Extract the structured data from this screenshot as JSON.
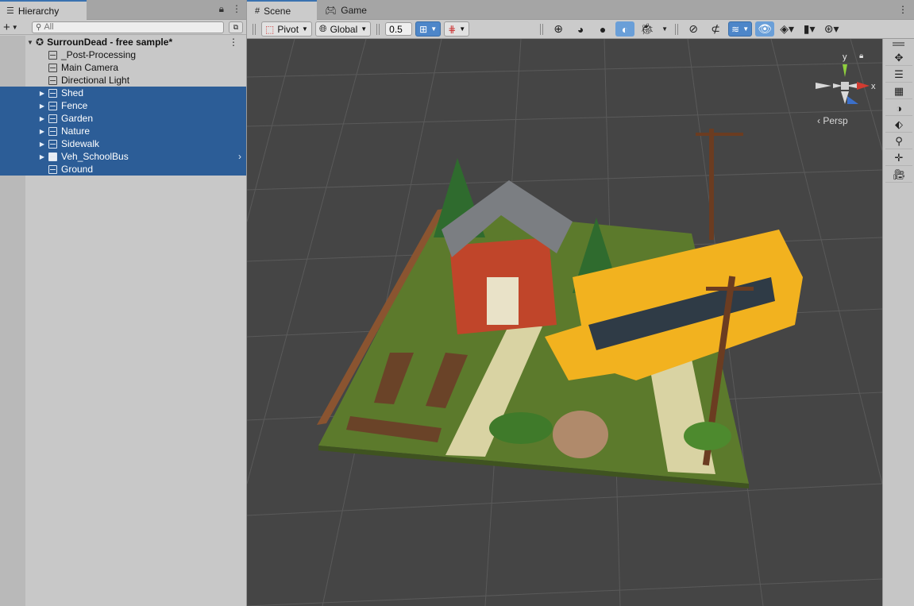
{
  "hierarchy": {
    "tab_label": "Hierarchy",
    "search_placeholder": "All",
    "scene_name": "SurrounDead - free sample*",
    "items": [
      {
        "label": "_Post-Processing",
        "selected": false,
        "expandable": false,
        "prefab": false
      },
      {
        "label": "Main Camera",
        "selected": false,
        "expandable": false,
        "prefab": false
      },
      {
        "label": "Directional Light",
        "selected": false,
        "expandable": false,
        "prefab": false
      },
      {
        "label": "Shed",
        "selected": true,
        "expandable": true,
        "prefab": false
      },
      {
        "label": "Fence",
        "selected": true,
        "expandable": true,
        "prefab": false
      },
      {
        "label": "Garden",
        "selected": true,
        "expandable": true,
        "prefab": false
      },
      {
        "label": "Nature",
        "selected": true,
        "expandable": true,
        "prefab": false
      },
      {
        "label": "Sidewalk",
        "selected": true,
        "expandable": true,
        "prefab": false
      },
      {
        "label": "Veh_SchoolBus",
        "selected": true,
        "expandable": true,
        "prefab": true
      },
      {
        "label": "Ground",
        "selected": true,
        "expandable": false,
        "prefab": false
      }
    ]
  },
  "scene_tabs": {
    "scene_label": "Scene",
    "game_label": "Game"
  },
  "toolbar": {
    "pivot_label": "Pivot",
    "global_label": "Global",
    "snap_value": "0.5"
  },
  "gizmo": {
    "y_label": "y",
    "x_label": "x",
    "persp_label": "Persp"
  },
  "colors": {
    "selection": "#2c5d97",
    "accent": "#3a72b0",
    "viewport_bg": "#444444"
  }
}
